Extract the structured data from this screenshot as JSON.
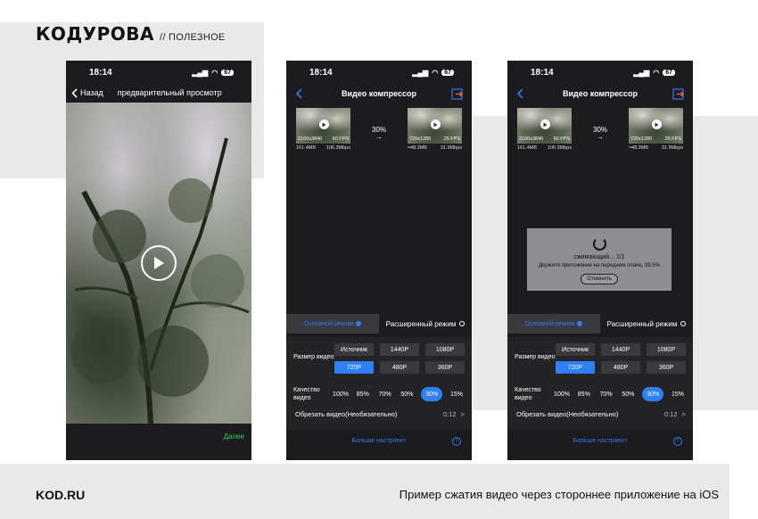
{
  "brand": {
    "logo": "КОДУРОВА",
    "tag": "// ПОЛЕЗНОЕ"
  },
  "footer": {
    "site": "KOD.RU",
    "caption": "Пример сжатия видео через стороннее приложение на iOS"
  },
  "status": {
    "time": "18:14",
    "battery": "67"
  },
  "preview": {
    "back_label": "Назад",
    "title": "предварительный просмотр",
    "next_label": "Далее"
  },
  "compressor": {
    "title": "Видео компрессор",
    "source": {
      "resolution": "2160x3840",
      "fps": "60 FPS",
      "size": "161.4MB",
      "bitrate": "106.3Mbps"
    },
    "target": {
      "resolution": "720x1280",
      "fps": "25 FPS",
      "size": "≈48.3MB",
      "bitrate": "31.9Mbps"
    },
    "compression": "30%",
    "arrow": "→",
    "mode_simple": "Основной режим",
    "mode_advanced": "Расширенный режим",
    "size_label": "Размер видео",
    "sizes": [
      "Источник",
      "1440P",
      "1080P",
      "720P",
      "480P",
      "360P"
    ],
    "selected_size": "720P",
    "quality_label_1": "Качество",
    "quality_label_2": "видео",
    "qualities": [
      "100%",
      "85%",
      "70%",
      "50%",
      "30%",
      "15%"
    ],
    "selected_quality": "30%",
    "trim_label": "Обрезать видео(Необязательно)",
    "trim_value": "0:12",
    "trim_chevron": ">",
    "more_label": "Больше настроек>",
    "help": "?"
  },
  "progress": {
    "title": "сжимающий... 1/1",
    "message": "Держите приложение на переднем плане, 39.5%",
    "percent": 39.5,
    "cancel_label": "Отменить"
  },
  "colors": {
    "accent": "#2f7ff6",
    "next": "#30d158",
    "panel": "#1c1c1e"
  }
}
